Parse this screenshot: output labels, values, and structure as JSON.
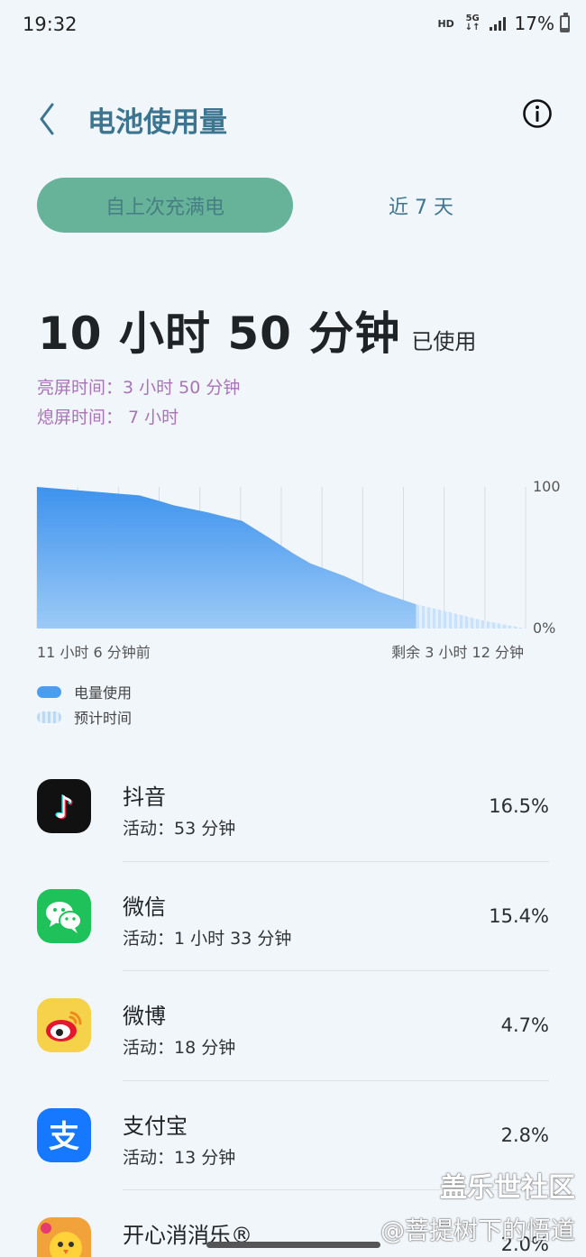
{
  "status_bar": {
    "time": "19:32",
    "hd": "HD",
    "network": "5G",
    "battery_percent": "17%",
    "battery_level": 0.17
  },
  "header": {
    "title": "电池使用量",
    "back_icon": "back-chevron-icon",
    "info_icon": "info-icon"
  },
  "tabs": {
    "active": "自上次充满电",
    "inactive": "近 7 天"
  },
  "usage": {
    "total": "10 小时 50 分钟",
    "suffix": "已使用",
    "screen_on": "亮屏时间：3 小时 50 分钟",
    "screen_off": "熄屏时间： 7 小时"
  },
  "chart_data": {
    "type": "area",
    "y_max_label": "100",
    "y_min_label": "0%",
    "x_start_label": "11 小时 6 分钟前",
    "x_end_label": "剩余 3 小时 12 分钟",
    "ylim": [
      0,
      100
    ],
    "xlim": [
      0,
      14.3
    ],
    "usage_series": {
      "x": [
        0,
        1,
        2,
        3,
        3.6,
        4,
        5,
        6,
        6.8,
        7.5,
        8,
        9,
        10,
        11.1
      ],
      "y": [
        100,
        98,
        96,
        94,
        90,
        87,
        82,
        76,
        64,
        53,
        46,
        37,
        26,
        17
      ]
    },
    "prediction_series": {
      "x": [
        11.1,
        12,
        13,
        14.3
      ],
      "y": [
        17,
        12,
        6,
        0
      ]
    },
    "colors": {
      "usage_top": "#3d93ee",
      "usage_bottom": "#9ccaf6",
      "prediction": "#c9e2fa"
    }
  },
  "legend": [
    {
      "label": "电量使用",
      "kind": "solid"
    },
    {
      "label": "预计时间",
      "kind": "predicted"
    }
  ],
  "apps": [
    {
      "name": "抖音",
      "activity": "活动：53 分钟",
      "percent": "16.5%",
      "icon": "douyin-icon"
    },
    {
      "name": "微信",
      "activity": "活动：1 小时 33 分钟",
      "percent": "15.4%",
      "icon": "wechat-icon"
    },
    {
      "name": "微博",
      "activity": "活动：18 分钟",
      "percent": "4.7%",
      "icon": "weibo-icon"
    },
    {
      "name": "支付宝",
      "activity": "活动：13 分钟",
      "percent": "2.8%",
      "icon": "alipay-icon"
    },
    {
      "name": "开心消消乐®",
      "activity": "",
      "percent": "2.0%",
      "icon": "happy-elimination-icon"
    }
  ],
  "watermark": {
    "line1": "盖乐世社区",
    "line2": "@菩提树下的悟道"
  }
}
